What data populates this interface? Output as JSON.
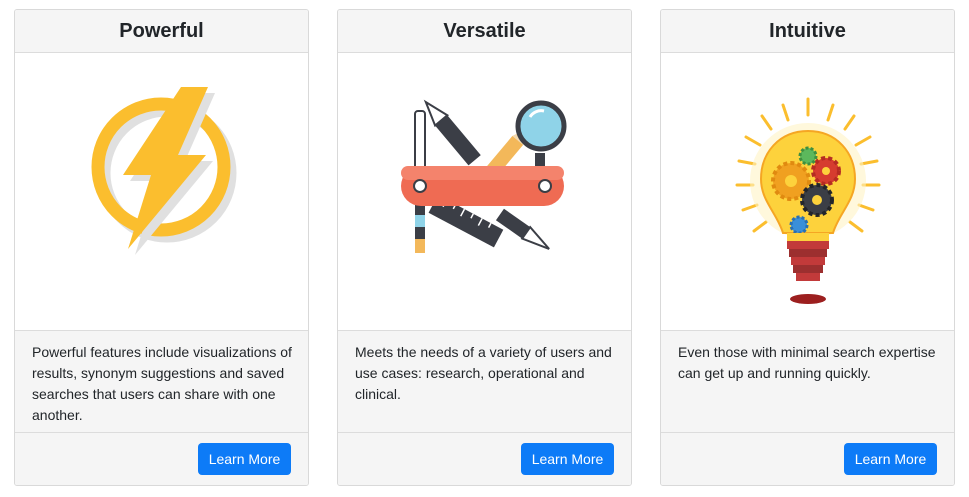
{
  "cards": [
    {
      "title": "Powerful",
      "image_icon": "lightning-bolt-icon",
      "description": "Powerful features include visualizations of results, synonym suggestions and saved searches that users can share with one another.",
      "button_label": "Learn More"
    },
    {
      "title": "Versatile",
      "image_icon": "multitool-icon",
      "description": "Meets the needs of a variety of users and use cases: research, operational and clinical.",
      "button_label": "Learn More"
    },
    {
      "title": "Intuitive",
      "image_icon": "lightbulb-gears-icon",
      "description": "Even those with minimal search expertise can get up and running quickly.",
      "button_label": "Learn More"
    }
  ],
  "colors": {
    "button": "#0d7bf7",
    "header_bg": "#f5f5f5",
    "bolt_yellow": "#fbbe2e",
    "tool_red": "#ef6b53",
    "magnifier_blue": "#8fd3e8"
  }
}
